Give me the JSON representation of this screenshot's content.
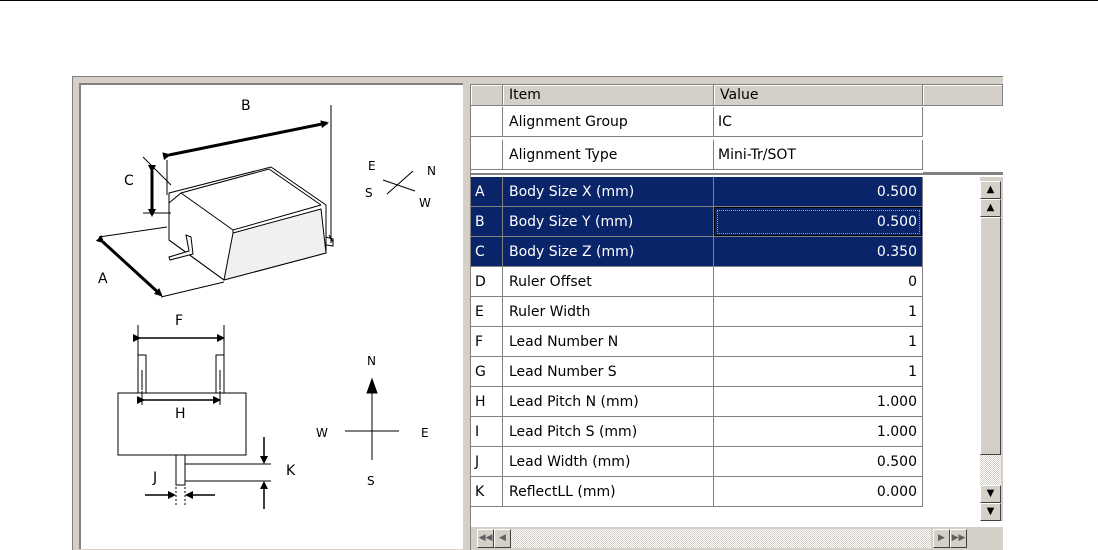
{
  "figure": {
    "labels": {
      "a": "A",
      "b": "B",
      "c": "C",
      "f": "F",
      "h": "H",
      "j": "J",
      "k": "K"
    },
    "compass_small": {
      "e": "E",
      "n": "N",
      "s": "S",
      "w": "W"
    },
    "compass_large": {
      "n": "N",
      "s": "S",
      "e": "E",
      "w": "W"
    }
  },
  "grid": {
    "headers": {
      "item": "Item",
      "value": "Value"
    },
    "fixed_rows": [
      {
        "item": "Alignment Group",
        "value": "IC"
      },
      {
        "item": "Alignment Type",
        "value": "Mini-Tr/SOT"
      }
    ],
    "rows": [
      {
        "key": "A",
        "item": "Body Size X (mm)",
        "value": "0.500",
        "selected": true
      },
      {
        "key": "B",
        "item": "Body Size Y (mm)",
        "value": "0.500",
        "selected": true
      },
      {
        "key": "C",
        "item": "Body Size Z (mm)",
        "value": "0.350",
        "selected": true
      },
      {
        "key": "D",
        "item": "Ruler Offset",
        "value": "0",
        "selected": false
      },
      {
        "key": "E",
        "item": "Ruler Width",
        "value": "1",
        "selected": false
      },
      {
        "key": "F",
        "item": "Lead Number N",
        "value": "1",
        "selected": false
      },
      {
        "key": "G",
        "item": "Lead Number S",
        "value": "1",
        "selected": false
      },
      {
        "key": "H",
        "item": "Lead Pitch N (mm)",
        "value": "1.000",
        "selected": false
      },
      {
        "key": "I",
        "item": "Lead Pitch S (mm)",
        "value": "1.000",
        "selected": false
      },
      {
        "key": "J",
        "item": "Lead Width (mm)",
        "value": "0.500",
        "selected": false
      },
      {
        "key": "K",
        "item": "ReflectLL (mm)",
        "value": "0.000",
        "selected": false
      }
    ]
  },
  "icons": {
    "scroll_top": "scroll-to-top-icon",
    "scroll_up": "scroll-up-icon",
    "scroll_down": "scroll-down-icon",
    "scroll_bottom": "scroll-to-bottom-icon",
    "scroll_first": "scroll-to-first-icon",
    "scroll_left": "scroll-left-icon",
    "scroll_right": "scroll-right-icon",
    "scroll_last": "scroll-to-last-icon"
  },
  "colors": {
    "selection": "#0a246a",
    "face": "#d4d0c8"
  }
}
